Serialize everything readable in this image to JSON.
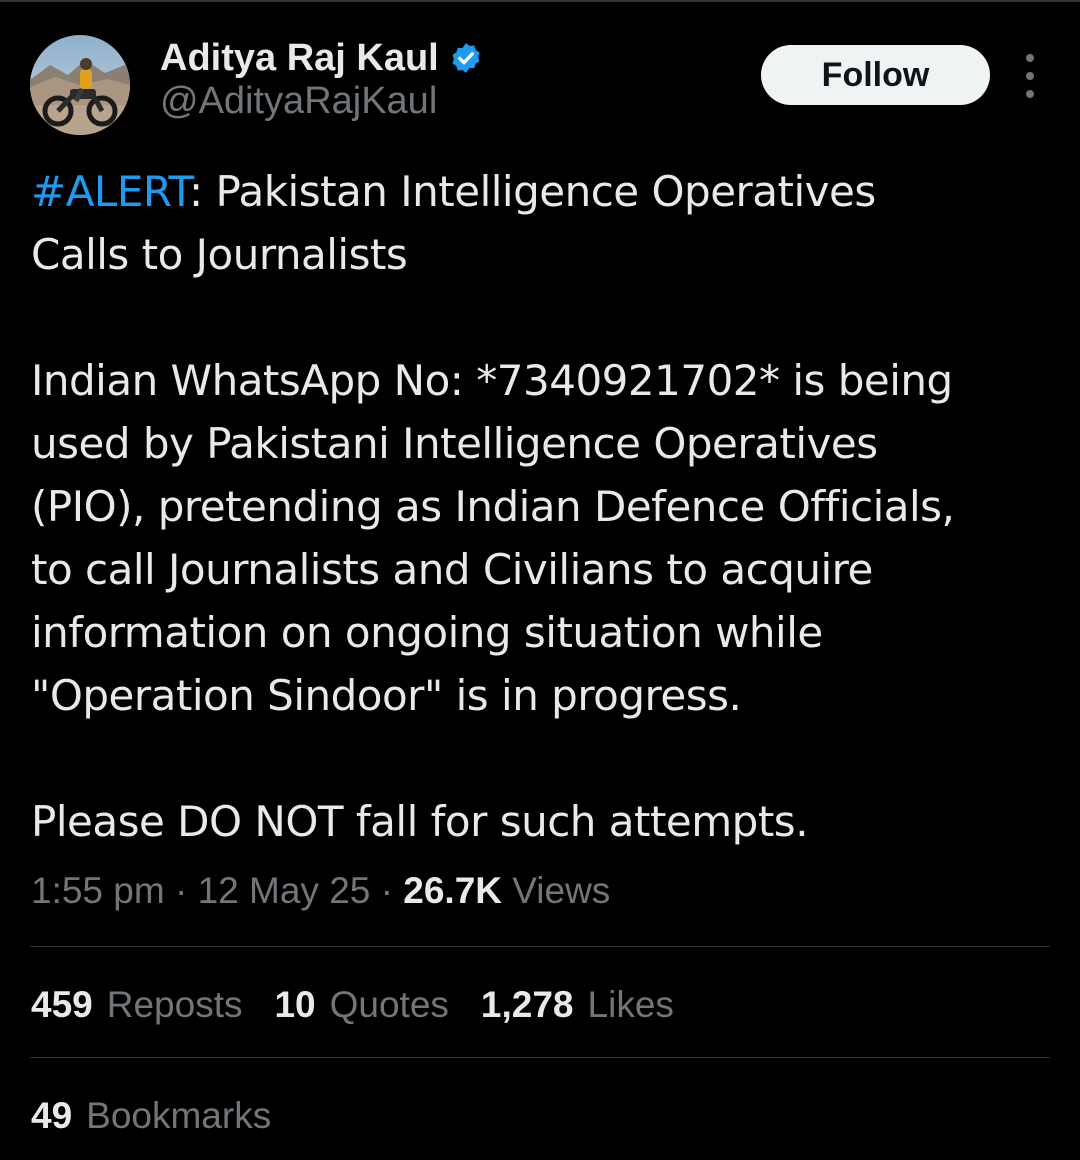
{
  "author": {
    "display_name": "Aditya Raj Kaul",
    "handle": "@AdityaRajKaul",
    "verified": true,
    "avatar_icon": "avatar-motorcycle-photo",
    "verified_icon": "verified-badge-icon"
  },
  "actions": {
    "follow_label": "Follow",
    "more_icon": "more-vertical-icon"
  },
  "tweet": {
    "hashtag": "#ALERT",
    "line1_rest": ": Pakistan Intelligence Operatives",
    "line2": "Calls to Journalists",
    "line3": "Indian WhatsApp No: *7340921702* is being",
    "line4": "used by Pakistani Intelligence Operatives",
    "line5": "(PIO), pretending as Indian Defence Officials,",
    "line6": "to call Journalists and Civilians to acquire",
    "line7": "information on ongoing situation while",
    "line8": "\"Operation Sindoor\" is in progress.",
    "line9": "Please DO NOT fall for such attempts."
  },
  "meta": {
    "time": "1:55 pm",
    "separator": " · ",
    "date": "12 May 25",
    "views_count": "26.7K",
    "views_label": "Views"
  },
  "stats": {
    "reposts_count": "459",
    "reposts_label": "Reposts",
    "quotes_count": "10",
    "quotes_label": "Quotes",
    "likes_count": "1,278",
    "likes_label": "Likes",
    "bookmarks_count": "49",
    "bookmarks_label": "Bookmarks"
  },
  "colors": {
    "background": "#000000",
    "text": "#e7e9ea",
    "secondary_text": "#71767b",
    "accent": "#1d9bf0",
    "divider": "#2f3336",
    "follow_button_bg": "#eff3f4"
  }
}
